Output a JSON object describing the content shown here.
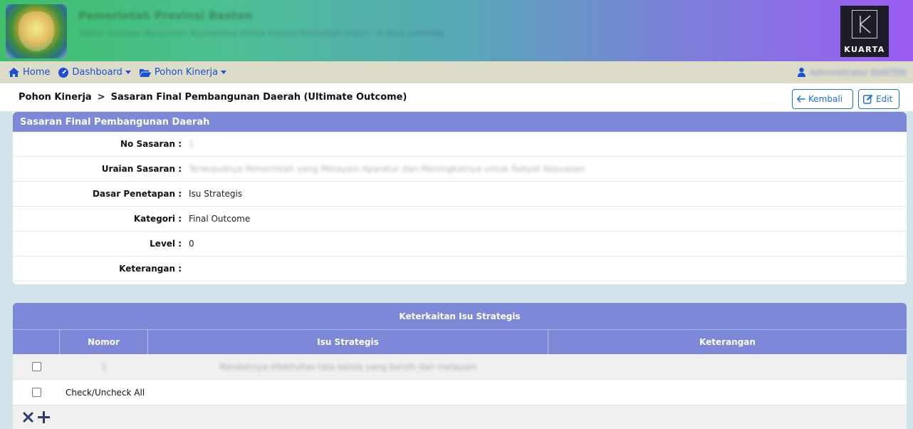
{
  "header": {
    "title": "Pemerintah Provinsi Banten",
    "subtitle": "Sistem Informasi Manajemen Akuntabilitas Kinerja Instansi Pemerintah (2022) - © 2024 (LATIHAN)",
    "brand": "KUARTA"
  },
  "nav": {
    "home": "Home",
    "dashboard": "Dashboard",
    "pohon_kinerja": "Pohon Kinerja",
    "user": "Administrator BANTEN"
  },
  "breadcrumb": {
    "parent": "Pohon Kinerja",
    "separator": ">",
    "current": "Sasaran Final Pembangunan Daerah (Ultimate Outcome)"
  },
  "buttons": {
    "back": "Kembali",
    "edit": "Edit"
  },
  "detail": {
    "header": "Sasaran Final Pembangunan Daerah",
    "fields": [
      {
        "label": "No Sasaran :",
        "value": "1"
      },
      {
        "label": "Uraian Sasaran :",
        "value": "Terwujudnya Pemerintah yang Melayani Aparatur dan Meningkatnya untuk Rakyat Kepuasan"
      },
      {
        "label": "Dasar Penetapan :",
        "value": "Isu Strategis"
      },
      {
        "label": "Kategori :",
        "value": "Final Outcome"
      },
      {
        "label": "Level :",
        "value": "0"
      },
      {
        "label": "Keterangan :",
        "value": ""
      }
    ]
  },
  "relation_table": {
    "title": "Keterkaitan Isu Strategis",
    "columns": [
      "Nomor",
      "Isu Strategis",
      "Keterangan"
    ],
    "rows": [
      {
        "nomor": "1",
        "isu": "Rendahnya efektivitas tata kelola yang bersih dan melayani",
        "keterangan": ""
      }
    ],
    "check_all_label": "Check/Uncheck All"
  },
  "colors": {
    "accent": "#7d88d9",
    "link": "#1a4fd6",
    "navbar_bg": "#dcdcc8",
    "page_bg": "#d3e3ea"
  },
  "icons": {
    "home": "home-icon",
    "dashboard": "gauge-icon",
    "folder": "folder-open-icon",
    "user": "user-icon",
    "back": "arrow-left-icon",
    "edit": "edit-icon",
    "delete": "close-icon",
    "add": "plus-icon"
  }
}
